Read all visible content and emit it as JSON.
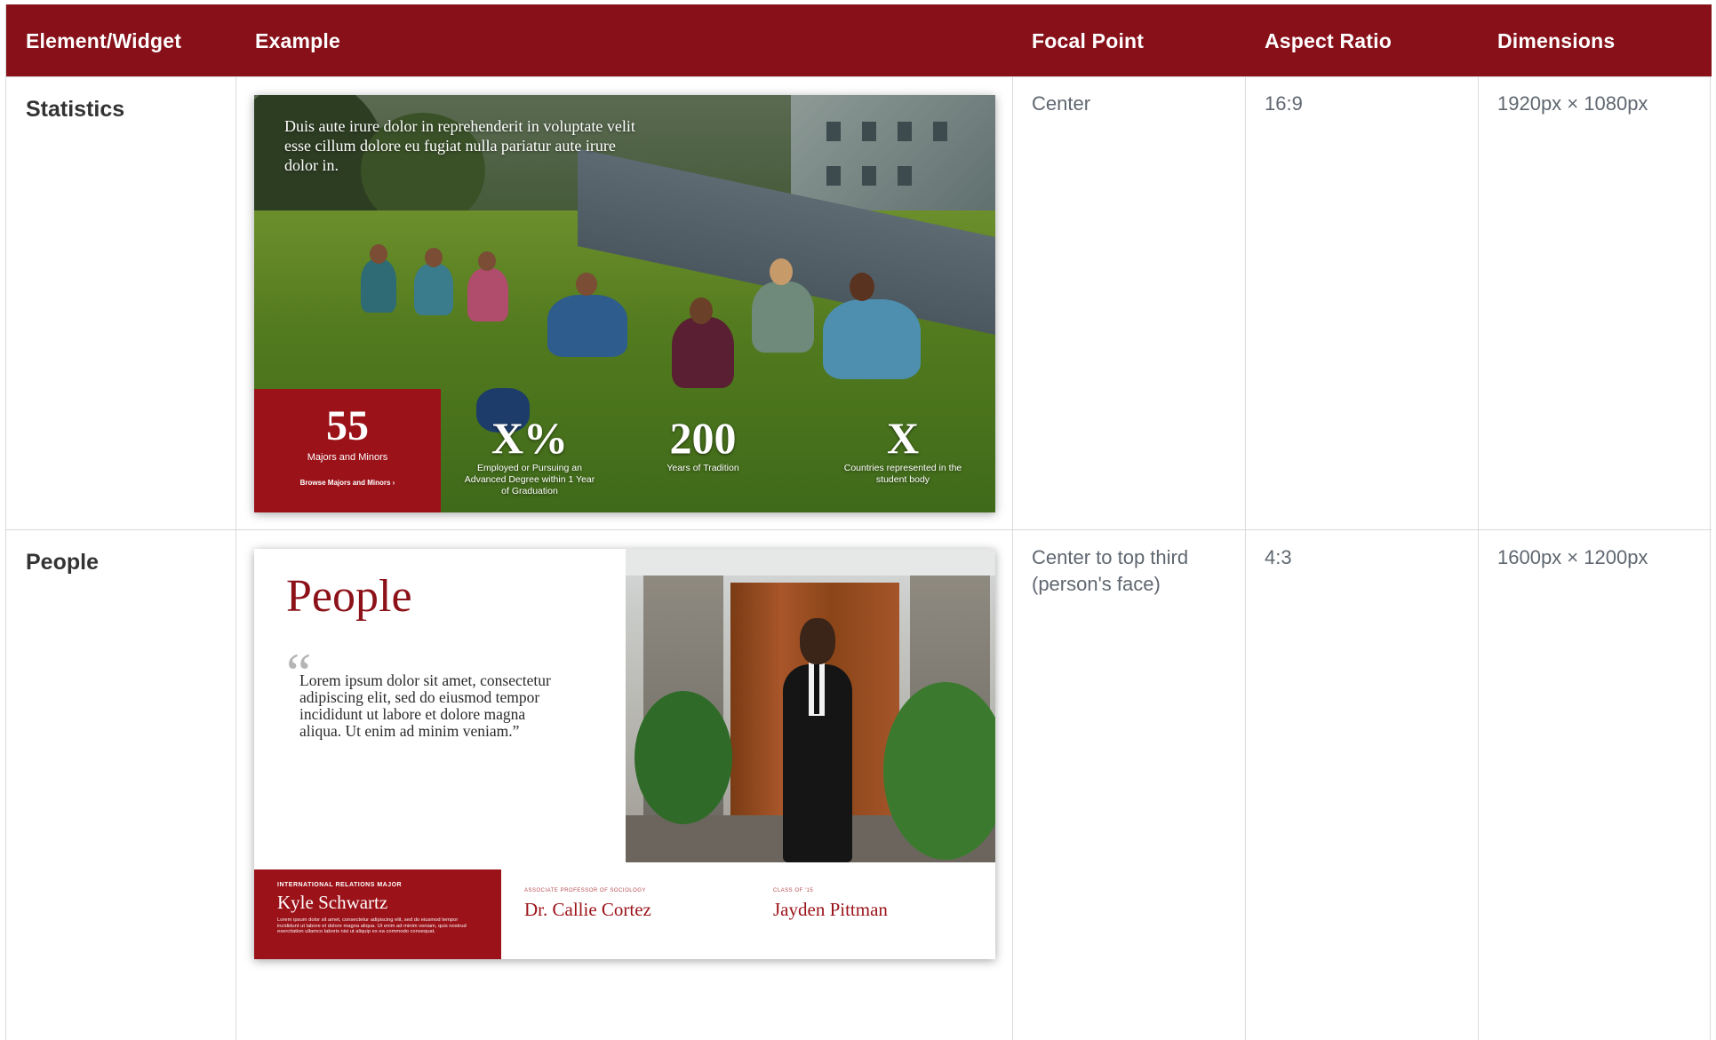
{
  "header": {
    "col_element": "Element/Widget",
    "col_example": "Example",
    "col_focal": "Focal Point",
    "col_aspect": "Aspect Ratio",
    "col_dimensions": "Dimensions"
  },
  "rows": [
    {
      "element": "Statistics",
      "focal_point": "Center",
      "aspect_ratio": "16:9",
      "dimensions": "1920px × 1080px",
      "example": {
        "caption": "Duis aute irure dolor in reprehenderit in voluptate velit esse cillum dolore eu fugiat nulla pariatur aute irure dolor in.",
        "box": {
          "number": "55",
          "label": "Majors and Minors",
          "link": "Browse Majors and Minors ›"
        },
        "stats": [
          {
            "number": "X%",
            "label": "Employed or Pursuing an Advanced Degree within 1 Year of Graduation"
          },
          {
            "number": "200",
            "label": "Years of Tradition"
          },
          {
            "number": "X",
            "label": "Countries represented in the student body"
          }
        ]
      }
    },
    {
      "element": "People",
      "focal_point": "Center to top third (person's face)",
      "aspect_ratio": "4:3",
      "dimensions": "1600px × 1200px",
      "example": {
        "title": "People",
        "quote_mark": "“",
        "quote": "Lorem ipsum dolor sit amet, consectetur adipiscing elit, sed do eiusmod tempor incididunt ut labore et dolore magna aliqua. Ut enim ad minim veniam.”",
        "featured": {
          "kicker": "INTERNATIONAL RELATIONS MAJOR",
          "name": "Kyle Schwartz",
          "blurb": "Lorem ipsum dolor sit amet, consectetur adipiscing elit, sed do eiusmod tempor incididunt ut labore et dolore magna aliqua. Ut enim ad minim veniam, quis nostrud exercitation ullamco laboris nisi ut aliquip ex ea commodo consequat."
        },
        "others": [
          {
            "kicker": "ASSOCIATE PROFESSOR OF SOCIOLOGY",
            "name": "Dr. Callie Cortez"
          },
          {
            "kicker": "CLASS OF '15",
            "name": "Jayden Pittman"
          }
        ]
      }
    }
  ]
}
